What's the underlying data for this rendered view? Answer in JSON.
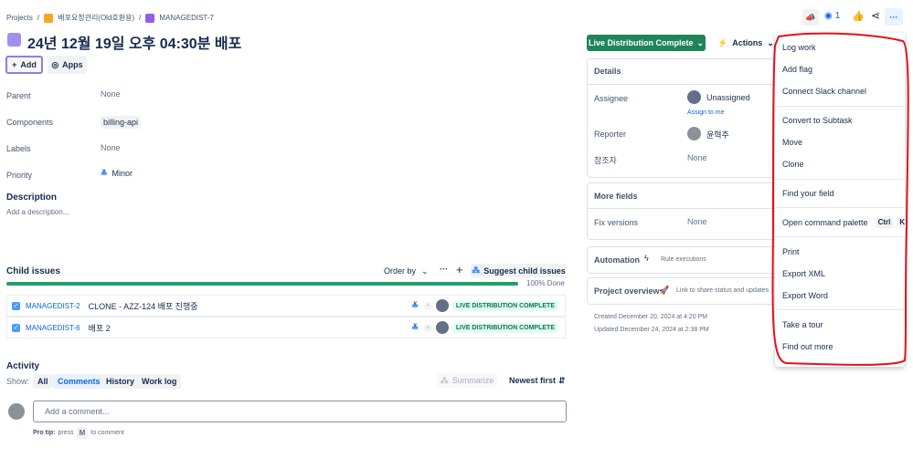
{
  "breadcrumb": {
    "projects": "Projects",
    "project": "배포요청관리(Old호환용)",
    "issue": "MANAGEDIST-7",
    "sep": "/"
  },
  "header_actions": {
    "watch_count": "1"
  },
  "title": "24년 12월 19일 오후 04:30분 배포",
  "buttons": {
    "add": "Add",
    "apps": "Apps"
  },
  "fields": [
    {
      "label": "Parent",
      "value": "None"
    },
    {
      "label": "Components",
      "value": "billing-api"
    },
    {
      "label": "Labels",
      "value": "None"
    },
    {
      "label": "Priority",
      "value": "Minor"
    }
  ],
  "description": {
    "heading": "Description",
    "placeholder": "Add a description..."
  },
  "child_issues": {
    "heading": "Child issues",
    "order_by": "Order by",
    "suggest": "Suggest child issues",
    "progress_percent": 100,
    "progress_label": "100% Done",
    "items": [
      {
        "key": "MANAGEDIST-2",
        "summary": "CLONE - AZZ-124 배포 진행중",
        "status": "LIVE DISTRIBUTION COMPLETE",
        "dash": "-"
      },
      {
        "key": "MANAGEDIST-6",
        "summary": "배포 2",
        "status": "LIVE DISTRIBUTION COMPLETE",
        "dash": "-"
      }
    ]
  },
  "activity": {
    "heading": "Activity",
    "show": "Show:",
    "tabs": [
      "All",
      "Comments",
      "History",
      "Work log"
    ],
    "summarize": "Summarize",
    "sort": "Newest first",
    "comment_placeholder": "Add a comment...",
    "pro_tip": "Pro tip:",
    "press": "press",
    "key": "M",
    "to_comment": "to comment"
  },
  "status_button": "Live Distribution Complete",
  "actions": "Actions",
  "details": {
    "heading": "Details",
    "assignee_label": "Assignee",
    "assignee": "Unassigned",
    "assign_to_me": "Assign to me",
    "reporter_label": "Reporter",
    "reporter": "윤혁주",
    "watchers_label": "참조자",
    "watchers": "None"
  },
  "more_fields": {
    "heading": "More fields",
    "fix_label": "Fix versions",
    "fix_value": "None"
  },
  "automation": {
    "heading": "Automation",
    "link": "Rule executions"
  },
  "project_overview": {
    "heading": "Project overview",
    "link": "Link to share status and updates"
  },
  "dates": {
    "created": "Created December 20, 2024 at 4:20 PM",
    "updated": "Updated December 24, 2024 at 2:38 PM"
  },
  "menu": {
    "log_work": "Log work",
    "add_flag": "Add flag",
    "connect_slack": "Connect Slack channel",
    "convert": "Convert to Subtask",
    "move": "Move",
    "clone": "Clone",
    "find_field": "Find your field",
    "command_palette": "Open command palette",
    "ctrl": "Ctrl",
    "k": "K",
    "print": "Print",
    "export_xml": "Export XML",
    "export_word": "Export Word",
    "tour": "Take a tour",
    "find_more": "Find out more"
  },
  "colors": {
    "accent": "#0c66e4",
    "status_green": "#1f845a",
    "progress": "#22a06b",
    "annotation": "#e2121b"
  }
}
